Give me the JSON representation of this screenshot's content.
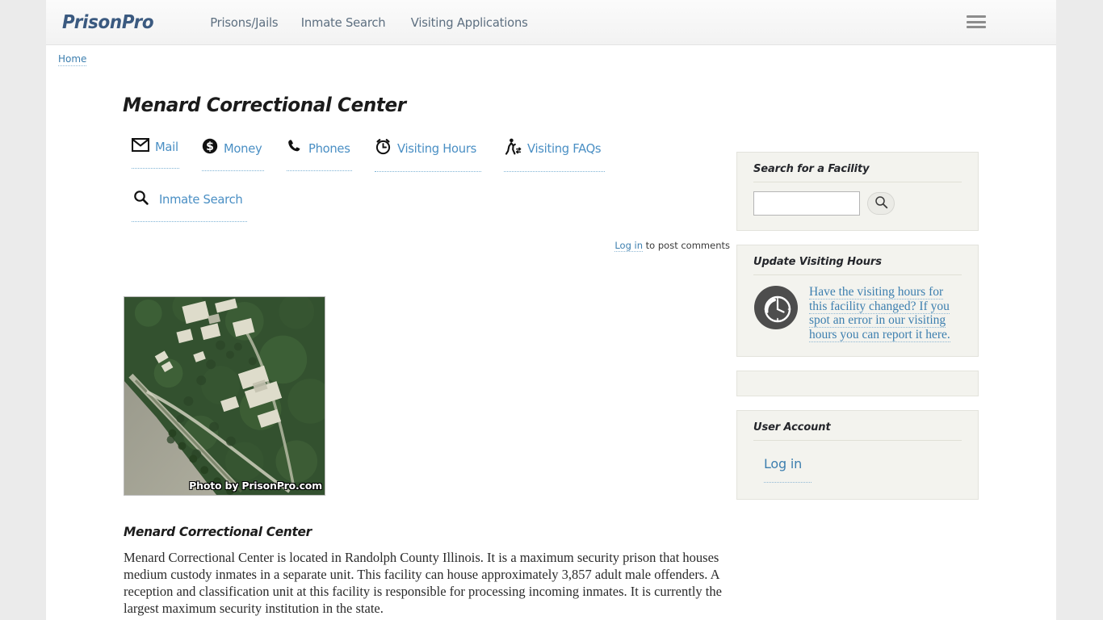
{
  "header": {
    "brand": "PrisonPro",
    "nav": [
      {
        "label": "Prisons/Jails"
      },
      {
        "label": "Inmate Search"
      },
      {
        "label": "Visiting Applications"
      }
    ],
    "menu_icon": "hamburger-icon"
  },
  "breadcrumb": {
    "home": "Home"
  },
  "main": {
    "title": "Menard Correctional Center",
    "icon_links_row1": [
      {
        "label": "Mail",
        "icon": "mail-icon"
      },
      {
        "label": "Money",
        "icon": "money-icon"
      },
      {
        "label": "Phones",
        "icon": "phone-icon"
      },
      {
        "label": "Visiting Hours",
        "icon": "alarm-clock-icon"
      },
      {
        "label": "Visiting FAQs",
        "icon": "walking-person-icon"
      }
    ],
    "icon_links_row2": [
      {
        "label": "Inmate Search",
        "icon": "search-icon"
      }
    ],
    "comments": {
      "link": "Log in",
      "text": " to post comments"
    },
    "photo": {
      "watermark": "Photo by PrisonPro.com",
      "alt": "satellite-aerial-view"
    },
    "article_title": "Menard Correctional Center",
    "article_body": "Menard Correctional Center is located in Randolph County Illinois.  It is a maximum security prison that houses medium custody inmates in a separate unit.  This facility can house approximately 3,857 adult male offenders.  A reception and classification unit at this facility is responsible for processing incoming inmates.  It is currently the largest maximum security institution in the state."
  },
  "sidebar": {
    "search_block": {
      "title": "Search for a Facility",
      "input_value": "",
      "input_placeholder": "",
      "button_icon": "search-icon"
    },
    "update_block": {
      "title": "Update Visiting Hours",
      "icon": "update-clock-icon",
      "link_text": "Have the visiting hours for this facility changed?  If you spot an error in our visiting hours you can report it here."
    },
    "empty_block": {
      "content": ""
    },
    "account_block": {
      "title": "User Account",
      "login_label": "Log in"
    }
  },
  "colors": {
    "page_bg": "#ebebeb",
    "content_bg": "#ffffff",
    "brand": "#3b5a80",
    "link_blue": "#4a8fc4",
    "nav_text": "#5d6f80",
    "sidebar_block": "#f3f3ee",
    "clock_badge": "#4d4d4d"
  }
}
